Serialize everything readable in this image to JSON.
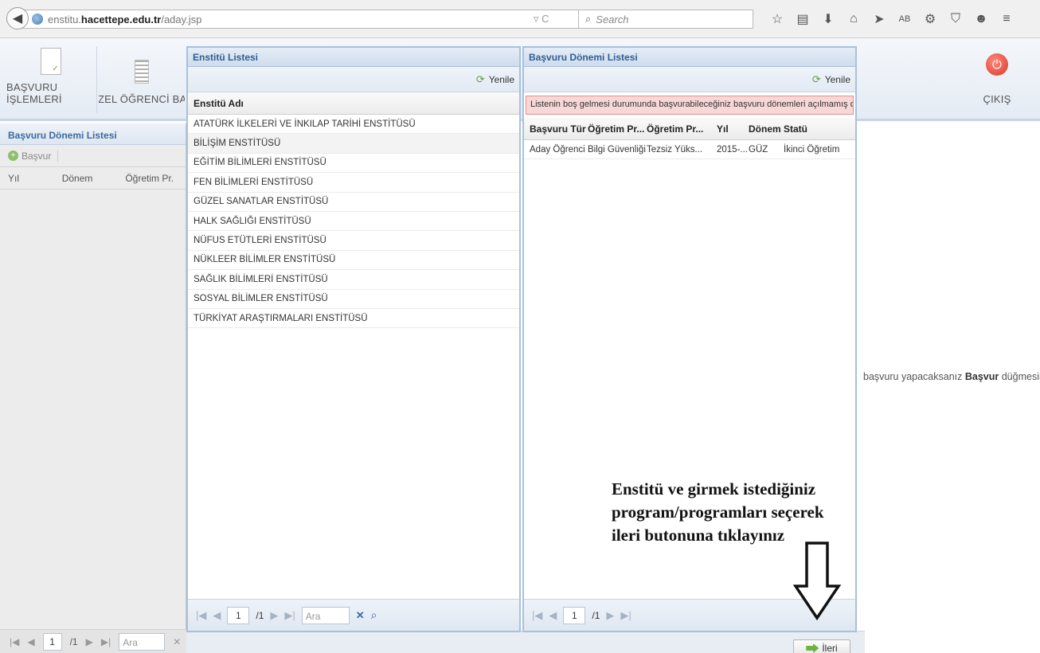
{
  "browser": {
    "url_host_prefix": "enstitu.",
    "url_host_main": "hacettepe.edu.tr",
    "url_path": "/aday.jsp",
    "search_placeholder": "Search",
    "ab_label": "AB"
  },
  "app": {
    "buttons": {
      "basvuru_islemleri": "BAŞVURU İŞLEMLERİ",
      "ozel_ogrenci": "ÖZEL ÖĞRENCİ BAŞ",
      "cikis": "ÇIKIŞ"
    },
    "left_panel": {
      "title": "Başvuru Dönemi Listesi",
      "basvur_label": "Başvur",
      "columns": [
        "Yıl",
        "Dönem",
        "Öğretim Pr."
      ],
      "page_current": "1",
      "page_total": "/1",
      "search_placeholder": "Ara"
    },
    "right_message": {
      "prefix": "başvuru yapacaksanız ",
      "bold": "Başvur",
      "suffix": " düğmesin"
    }
  },
  "enstitu_panel": {
    "title": "Enstitü Listesi",
    "refresh_label": "Yenile",
    "column": "Enstitü Adı",
    "items": [
      "ATATÜRK İLKELERİ VE İNKILAP TARİHİ ENSTİTÜSÜ",
      "BİLİŞİM ENSTİTÜSÜ",
      "EĞİTİM BİLİMLERİ ENSTİTÜSÜ",
      "FEN BİLİMLERİ ENSTİTÜSÜ",
      "GÜZEL SANATLAR ENSTİTÜSÜ",
      "HALK SAĞLIĞI ENSTİTÜSÜ",
      "NÜFUS ETÜTLERİ ENSTİTÜSÜ",
      "NÜKLEER BİLİMLER ENSTİTÜSÜ",
      "SAĞLIK BİLİMLERİ ENSTİTÜSÜ",
      "SOSYAL BİLİMLER ENSTİTÜSÜ",
      "TÜRKİYAT ARAŞTIRMALARI ENSTİTÜSÜ"
    ],
    "page_current": "1",
    "page_total": "/1",
    "search_placeholder": "Ara"
  },
  "donem_panel": {
    "title": "Başvuru Dönemi Listesi",
    "refresh_label": "Yenile",
    "warning": "Listenin boş gelmesi durumunda başvurabileceğiniz başvuru dönemleri açılmamış demektir",
    "columns": [
      "Başvuru Tür",
      "Öğretim Pr...",
      "Öğretim Pr...",
      "Yıl",
      "Dönem",
      "Statü"
    ],
    "row": [
      "Aday Öğrenci",
      "Bilgi Güvenliği",
      "Tezsiz Yüks...",
      "2015-...",
      "GÜZ",
      "İkinci Öğretim"
    ],
    "page_current": "1",
    "page_total": "/1"
  },
  "ileri_label": "İleri",
  "instruction": {
    "line1": "Enstitü ve girmek istediğiniz",
    "line2": "program/programları seçerek",
    "line3": "ileri butonuna tıklayınız"
  }
}
